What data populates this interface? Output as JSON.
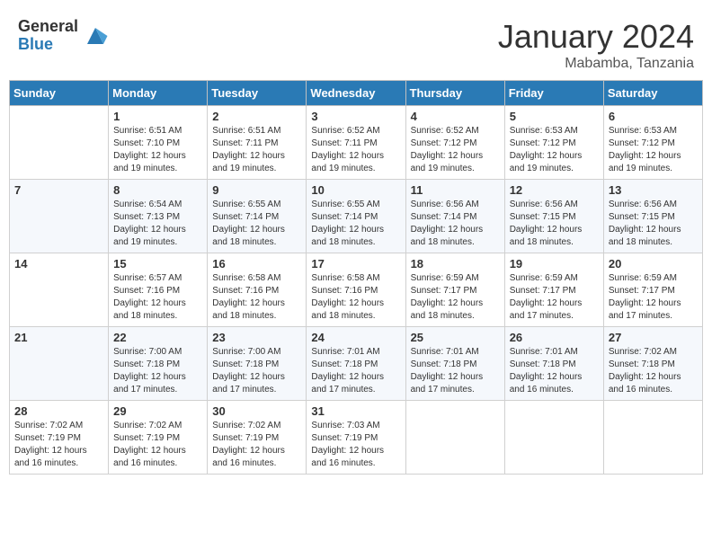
{
  "header": {
    "logo_general": "General",
    "logo_blue": "Blue",
    "month_title": "January 2024",
    "subtitle": "Mabamba, Tanzania"
  },
  "days_of_week": [
    "Sunday",
    "Monday",
    "Tuesday",
    "Wednesday",
    "Thursday",
    "Friday",
    "Saturday"
  ],
  "weeks": [
    [
      {
        "day": null,
        "info": null
      },
      {
        "day": "1",
        "info": "Sunrise: 6:51 AM\nSunset: 7:10 PM\nDaylight: 12 hours and 19 minutes."
      },
      {
        "day": "2",
        "info": "Sunrise: 6:51 AM\nSunset: 7:11 PM\nDaylight: 12 hours and 19 minutes."
      },
      {
        "day": "3",
        "info": "Sunrise: 6:52 AM\nSunset: 7:11 PM\nDaylight: 12 hours and 19 minutes."
      },
      {
        "day": "4",
        "info": "Sunrise: 6:52 AM\nSunset: 7:12 PM\nDaylight: 12 hours and 19 minutes."
      },
      {
        "day": "5",
        "info": "Sunrise: 6:53 AM\nSunset: 7:12 PM\nDaylight: 12 hours and 19 minutes."
      },
      {
        "day": "6",
        "info": "Sunrise: 6:53 AM\nSunset: 7:12 PM\nDaylight: 12 hours and 19 minutes."
      }
    ],
    [
      {
        "day": "7",
        "info": ""
      },
      {
        "day": "8",
        "info": "Sunrise: 6:54 AM\nSunset: 7:13 PM\nDaylight: 12 hours and 19 minutes."
      },
      {
        "day": "9",
        "info": "Sunrise: 6:55 AM\nSunset: 7:14 PM\nDaylight: 12 hours and 18 minutes."
      },
      {
        "day": "10",
        "info": "Sunrise: 6:55 AM\nSunset: 7:14 PM\nDaylight: 12 hours and 18 minutes."
      },
      {
        "day": "11",
        "info": "Sunrise: 6:56 AM\nSunset: 7:14 PM\nDaylight: 12 hours and 18 minutes."
      },
      {
        "day": "12",
        "info": "Sunrise: 6:56 AM\nSunset: 7:15 PM\nDaylight: 12 hours and 18 minutes."
      },
      {
        "day": "13",
        "info": "Sunrise: 6:56 AM\nSunset: 7:15 PM\nDaylight: 12 hours and 18 minutes."
      }
    ],
    [
      {
        "day": "14",
        "info": ""
      },
      {
        "day": "15",
        "info": "Sunrise: 6:57 AM\nSunset: 7:16 PM\nDaylight: 12 hours and 18 minutes."
      },
      {
        "day": "16",
        "info": "Sunrise: 6:58 AM\nSunset: 7:16 PM\nDaylight: 12 hours and 18 minutes."
      },
      {
        "day": "17",
        "info": "Sunrise: 6:58 AM\nSunset: 7:16 PM\nDaylight: 12 hours and 18 minutes."
      },
      {
        "day": "18",
        "info": "Sunrise: 6:59 AM\nSunset: 7:17 PM\nDaylight: 12 hours and 18 minutes."
      },
      {
        "day": "19",
        "info": "Sunrise: 6:59 AM\nSunset: 7:17 PM\nDaylight: 12 hours and 17 minutes."
      },
      {
        "day": "20",
        "info": "Sunrise: 6:59 AM\nSunset: 7:17 PM\nDaylight: 12 hours and 17 minutes."
      }
    ],
    [
      {
        "day": "21",
        "info": ""
      },
      {
        "day": "22",
        "info": "Sunrise: 7:00 AM\nSunset: 7:18 PM\nDaylight: 12 hours and 17 minutes."
      },
      {
        "day": "23",
        "info": "Sunrise: 7:00 AM\nSunset: 7:18 PM\nDaylight: 12 hours and 17 minutes."
      },
      {
        "day": "24",
        "info": "Sunrise: 7:01 AM\nSunset: 7:18 PM\nDaylight: 12 hours and 17 minutes."
      },
      {
        "day": "25",
        "info": "Sunrise: 7:01 AM\nSunset: 7:18 PM\nDaylight: 12 hours and 17 minutes."
      },
      {
        "day": "26",
        "info": "Sunrise: 7:01 AM\nSunset: 7:18 PM\nDaylight: 12 hours and 16 minutes."
      },
      {
        "day": "27",
        "info": "Sunrise: 7:02 AM\nSunset: 7:18 PM\nDaylight: 12 hours and 16 minutes."
      }
    ],
    [
      {
        "day": "28",
        "info": "Sunrise: 7:02 AM\nSunset: 7:19 PM\nDaylight: 12 hours and 16 minutes."
      },
      {
        "day": "29",
        "info": "Sunrise: 7:02 AM\nSunset: 7:19 PM\nDaylight: 12 hours and 16 minutes."
      },
      {
        "day": "30",
        "info": "Sunrise: 7:02 AM\nSunset: 7:19 PM\nDaylight: 12 hours and 16 minutes."
      },
      {
        "day": "31",
        "info": "Sunrise: 7:03 AM\nSunset: 7:19 PM\nDaylight: 12 hours and 16 minutes."
      },
      {
        "day": null,
        "info": null
      },
      {
        "day": null,
        "info": null
      },
      {
        "day": null,
        "info": null
      }
    ]
  ]
}
